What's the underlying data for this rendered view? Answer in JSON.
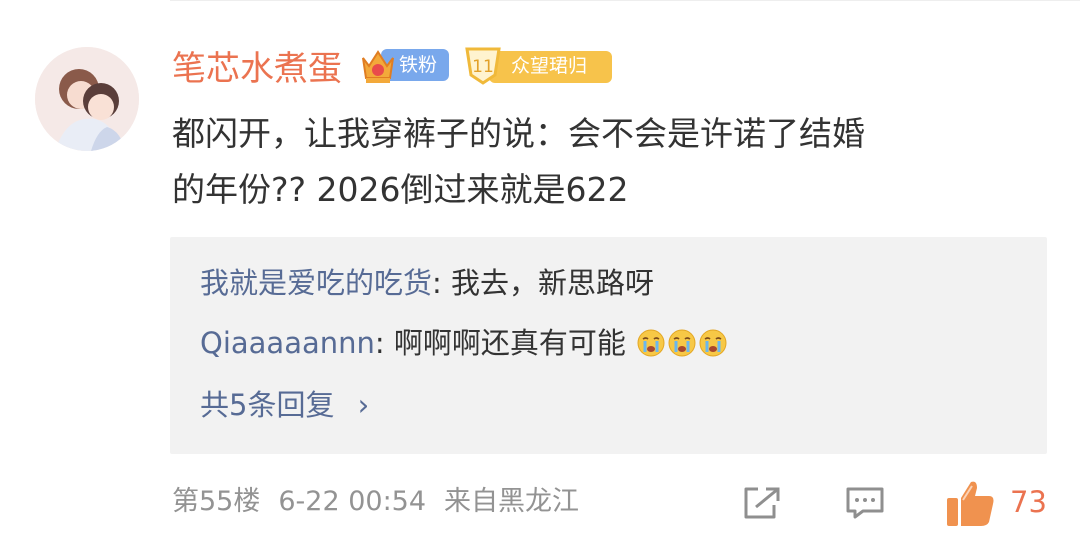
{
  "comment": {
    "username": "笔芯水煮蛋",
    "badges": {
      "fan_label": "铁粉",
      "level_number": "11",
      "level_label": "众望珺归"
    },
    "text_line1": "都闪开，让我穿裤子的说：会不会是许诺了结婚",
    "text_line2": "的年份?? 2026倒过来就是622"
  },
  "replies": {
    "items": [
      {
        "author": "我就是爱吃的吃货",
        "sep": ": ",
        "text": "我去，新思路呀"
      },
      {
        "author": "Qiaaaaannn",
        "sep": ": ",
        "text": "啊啊啊还真有可能"
      }
    ],
    "emoji_name": "crying-face-icon",
    "more_label": "共5条回复",
    "more_chevron": "›"
  },
  "footer": {
    "floor": "第55楼",
    "time": "6-22 00:54",
    "location": "来自黑龙江",
    "like_count": "73"
  },
  "colors": {
    "username": "#eb7350",
    "reply_author": "#576b95",
    "reply_bg": "#f2f2f2",
    "meta": "#939393"
  }
}
